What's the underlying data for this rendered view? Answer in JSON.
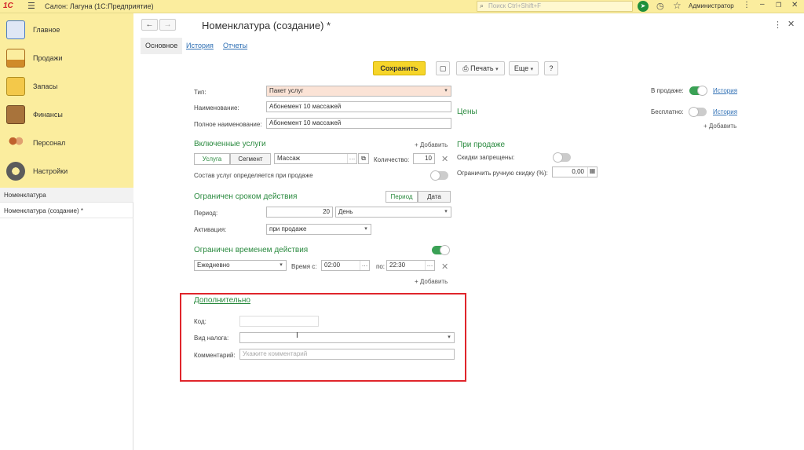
{
  "titlebar": {
    "logo": "1С",
    "app_title": "Салон: Лагуна  (1С:Предприятие)",
    "search_placeholder": "Поиск Ctrl+Shift+F",
    "user": "Администратор"
  },
  "sidebar": {
    "items": [
      {
        "label": "Главное",
        "icon": "clipboard-icon",
        "color": "#4a7cc0"
      },
      {
        "label": "Продажи",
        "icon": "sales-chart-icon",
        "color": "#d08b2a"
      },
      {
        "label": "Запасы",
        "icon": "inventory-icon",
        "color": "#c9a227"
      },
      {
        "label": "Финансы",
        "icon": "wallet-icon",
        "color": "#8a5a2b"
      },
      {
        "label": "Персонал",
        "icon": "staff-icon",
        "color": "#c0622d"
      },
      {
        "label": "Настройки",
        "icon": "gear-icon",
        "color": "#5c5c5c"
      }
    ],
    "open_windows": [
      "Номенклатура",
      "Номенклатура (создание) *"
    ]
  },
  "form": {
    "title": "Номенклатура (создание) *",
    "tabs": [
      "Основное",
      "История",
      "Отчеты"
    ],
    "toolbar": {
      "save": "Сохранить",
      "print": "Печать",
      "more": "Еще",
      "help": "?"
    },
    "type_label": "Тип:",
    "type_value": "Пакет услуг",
    "name_label": "Наименование:",
    "name_value": "Абонемент 10 массажей",
    "fullname_label": "Полное наименование:",
    "fullname_value": "Абонемент 10 массажей",
    "included": {
      "title": "Включенные услуги",
      "add": "+ Добавить",
      "seg_service": "Услуга",
      "seg_segment": "Сегмент",
      "service_value": "Массаж",
      "qty_label": "Количество:",
      "qty_value": "10",
      "composition_label": "Состав услуг определяется при продаже"
    },
    "duration": {
      "title": "Ограничен сроком действия",
      "seg_period": "Период",
      "seg_date": "Дата",
      "period_label": "Период:",
      "period_value": "20",
      "period_unit": "День",
      "activation_label": "Активация:",
      "activation_value": "при продаже"
    },
    "timelimit": {
      "title": "Ограничен временем действия",
      "schedule_value": "Ежедневно",
      "time_from_label": "Время с:",
      "time_from": "02:00",
      "time_to_label": "по:",
      "time_to": "22:30",
      "add": "+ Добавить"
    },
    "additional": {
      "title": "Дополнительно",
      "code_label": "Код:",
      "tax_label": "Вид налога:",
      "comment_label": "Комментарий:",
      "comment_placeholder": "Укажите комментарий"
    },
    "right": {
      "onsale_label": "В продаже:",
      "history": "История",
      "free_label": "Бесплатно:",
      "add": "+ Добавить",
      "prices_title": "Цены",
      "atsale_title": "При продаже",
      "discounts_label": "Скидки запрещены:",
      "limit_label": "Ограничить ручную скидку (%):",
      "limit_value": "0,00"
    }
  }
}
